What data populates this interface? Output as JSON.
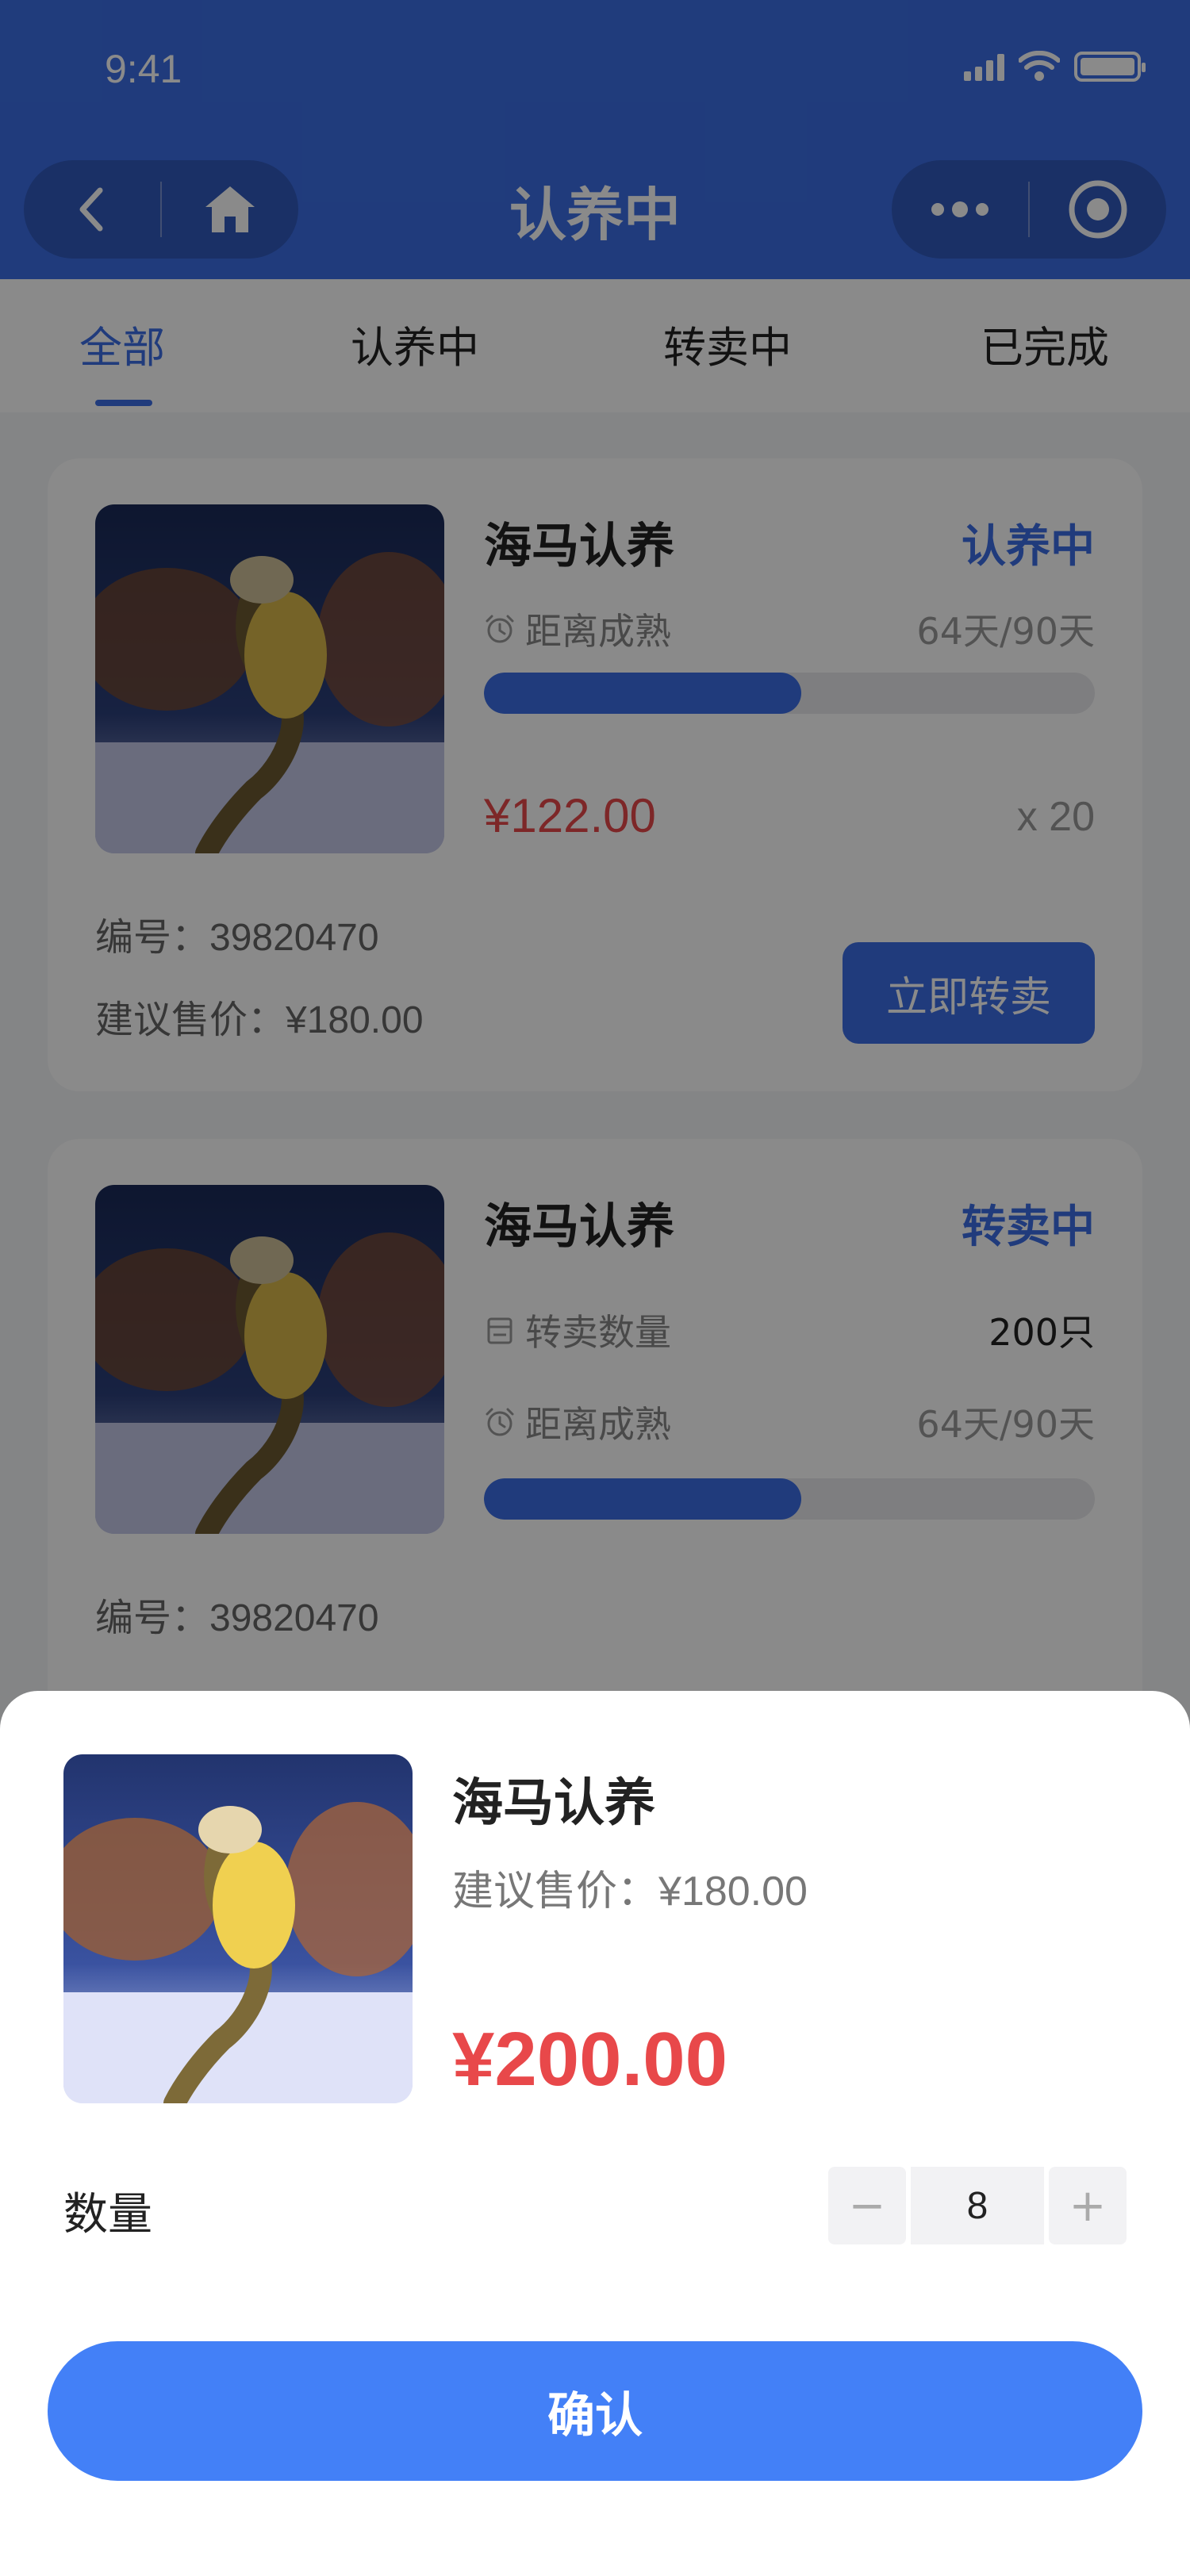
{
  "status_bar": {
    "time": "9:41"
  },
  "nav": {
    "title": "认养中"
  },
  "tabs": [
    {
      "label": "全部",
      "active": true
    },
    {
      "label": "认养中",
      "active": false
    },
    {
      "label": "转卖中",
      "active": false
    },
    {
      "label": "已完成",
      "active": false
    }
  ],
  "cards": [
    {
      "title": "海马认养",
      "status": "认养中",
      "maturity_label": "距离成熟",
      "maturity_value": "64天/90天",
      "progress": 0.52,
      "price": "¥122.00",
      "quantity": "x 20",
      "code": "编号：39820470",
      "suggest_price": "建议售价：¥180.00",
      "action": "立即转卖"
    },
    {
      "title": "海马认养",
      "status": "转卖中",
      "resell_qty_label": "转卖数量",
      "resell_qty_value": "200只",
      "maturity_label": "距离成熟",
      "maturity_value": "64天/90天",
      "progress": 0.52,
      "code": "编号：39820470"
    }
  ],
  "sheet": {
    "title": "海马认养",
    "suggest_price": "建议售价：¥180.00",
    "price": "¥200.00",
    "quantity_label": "数量",
    "quantity_value": "8",
    "minus": "−",
    "plus": "+",
    "confirm_label": "确认"
  },
  "colors": {
    "primary": "#3b6ee6",
    "price_red": "#e8484a",
    "confirm_blue": "#4380f7"
  }
}
